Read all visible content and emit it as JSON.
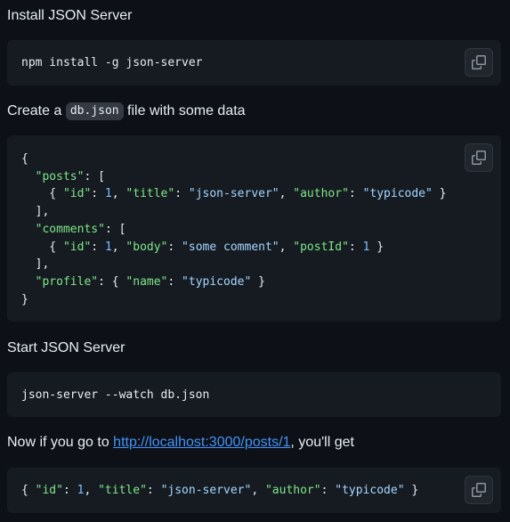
{
  "sections": {
    "install": {
      "heading": "Install JSON Server",
      "command": "npm install -g json-server",
      "copy_icon": "copy-icon"
    },
    "create": {
      "text_before": "Create a ",
      "filename": "db.json",
      "text_after": " file with some data",
      "copy_icon": "copy-icon",
      "code": {
        "open_brace": "{",
        "posts_key": "\"posts\"",
        "posts_open": ": [",
        "post_id_key": "\"id\"",
        "post_id_val": "1",
        "post_title_key": "\"title\"",
        "post_title_val": "\"json-server\"",
        "post_author_key": "\"author\"",
        "post_author_val": "\"typicode\"",
        "posts_close": "],",
        "comments_key": "\"comments\"",
        "comments_open": ": [",
        "comment_id_key": "\"id\"",
        "comment_id_val": "1",
        "comment_body_key": "\"body\"",
        "comment_body_val": "\"some comment\"",
        "comment_postid_key": "\"postId\"",
        "comment_postid_val": "1",
        "comments_close": "],",
        "profile_key": "\"profile\"",
        "profile_name_key": "\"name\"",
        "profile_name_val": "\"typicode\"",
        "close_brace": "}"
      }
    },
    "start": {
      "heading": "Start JSON Server",
      "command": "json-server --watch db.json"
    },
    "result": {
      "text_before": "Now if you go to ",
      "link": "http://localhost:3000/posts/1",
      "text_after": ", you'll get",
      "copy_icon": "copy-icon",
      "code": {
        "id_key": "\"id\"",
        "id_val": "1",
        "title_key": "\"title\"",
        "title_val": "\"json-server\"",
        "author_key": "\"author\"",
        "author_val": "\"typicode\""
      }
    }
  },
  "colors": {
    "background": "#0d1117",
    "code_background": "#161b22",
    "text": "#e6edf3",
    "link": "#4493f8",
    "json_key": "#7ee787",
    "json_string": "#a5d6ff",
    "json_number": "#79c0ff"
  }
}
